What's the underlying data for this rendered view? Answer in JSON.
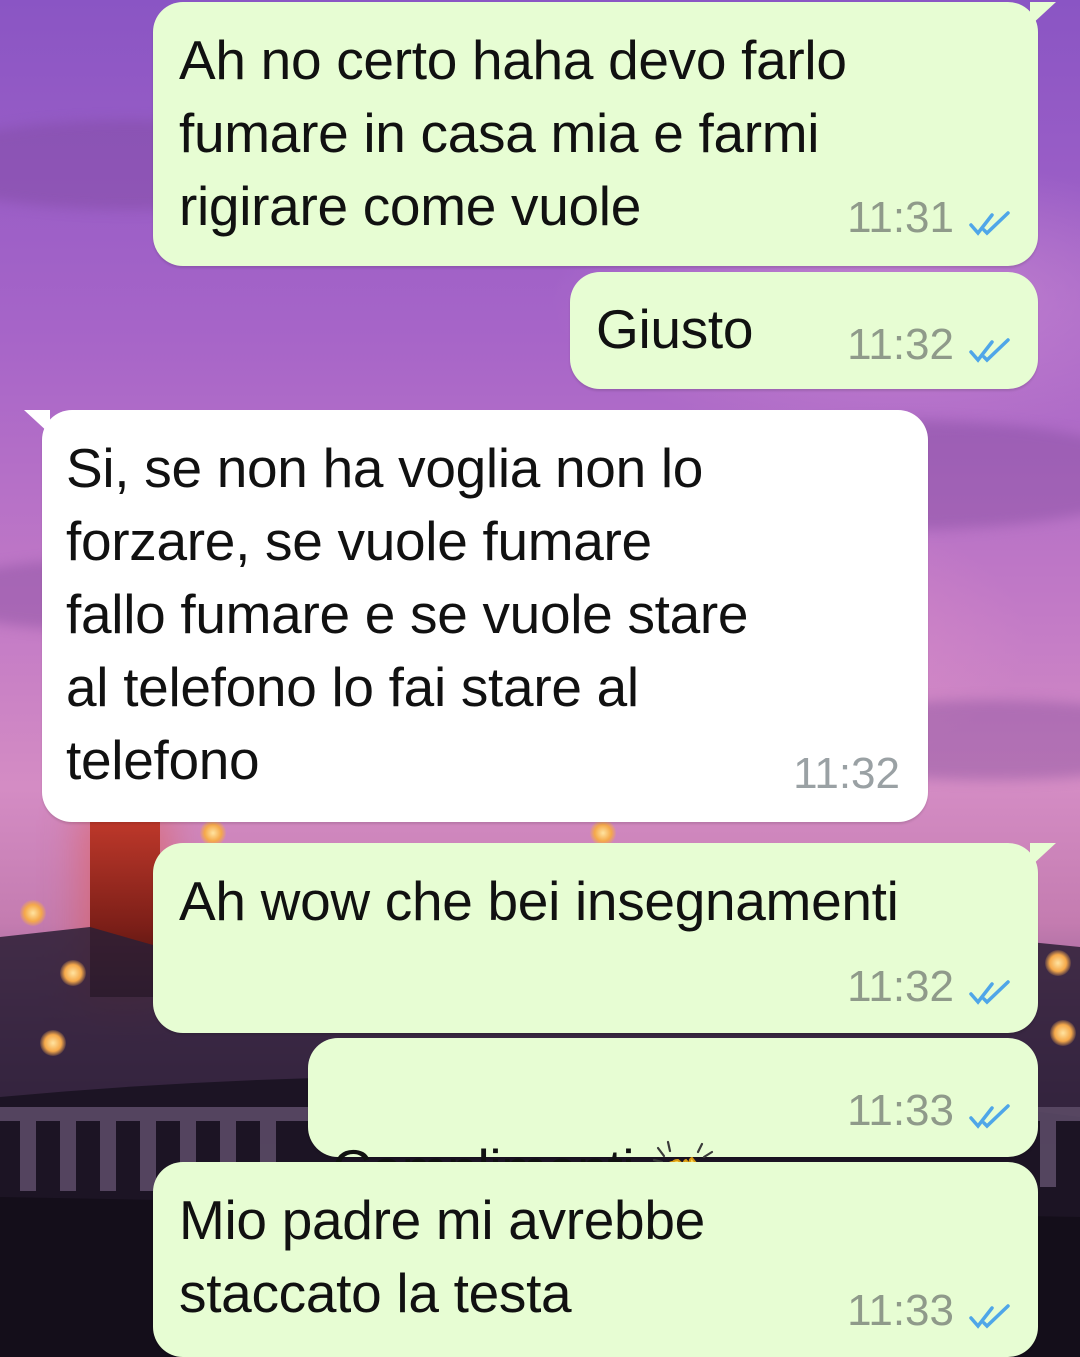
{
  "chat": {
    "messages": [
      {
        "direction": "outgoing",
        "text": "Ah no certo haha devo farlo\nfumare in casa mia e farmi\nrigirare come vuole",
        "time": "11:31",
        "status": "read"
      },
      {
        "direction": "outgoing",
        "text": "Giusto",
        "time": "11:32",
        "status": "read"
      },
      {
        "direction": "incoming",
        "text": "Si, se non ha voglia non lo\nforzare, se vuole fumare\nfallo fumare e se vuole stare\nal telefono lo fai stare al\ntelefono",
        "time": "11:32"
      },
      {
        "direction": "outgoing",
        "text": "Ah wow che bei insegnamenti",
        "time": "11:32",
        "status": "read"
      },
      {
        "direction": "outgoing",
        "text": "Complimenti",
        "emoji": "clapping-hands",
        "time": "11:33",
        "status": "read"
      },
      {
        "direction": "outgoing",
        "text": "Mio padre mi avrebbe\nstaccato la testa",
        "time": "11:33",
        "status": "read"
      }
    ]
  },
  "colors": {
    "outgoing_bubble": "#e7fdd3",
    "incoming_bubble": "#ffffff",
    "read_ticks": "#4fa6e8",
    "timestamp": "#8f9a8a"
  },
  "icons": {
    "read_receipt": "double-check-icon",
    "emoji": "clapping-hands-emoji"
  }
}
